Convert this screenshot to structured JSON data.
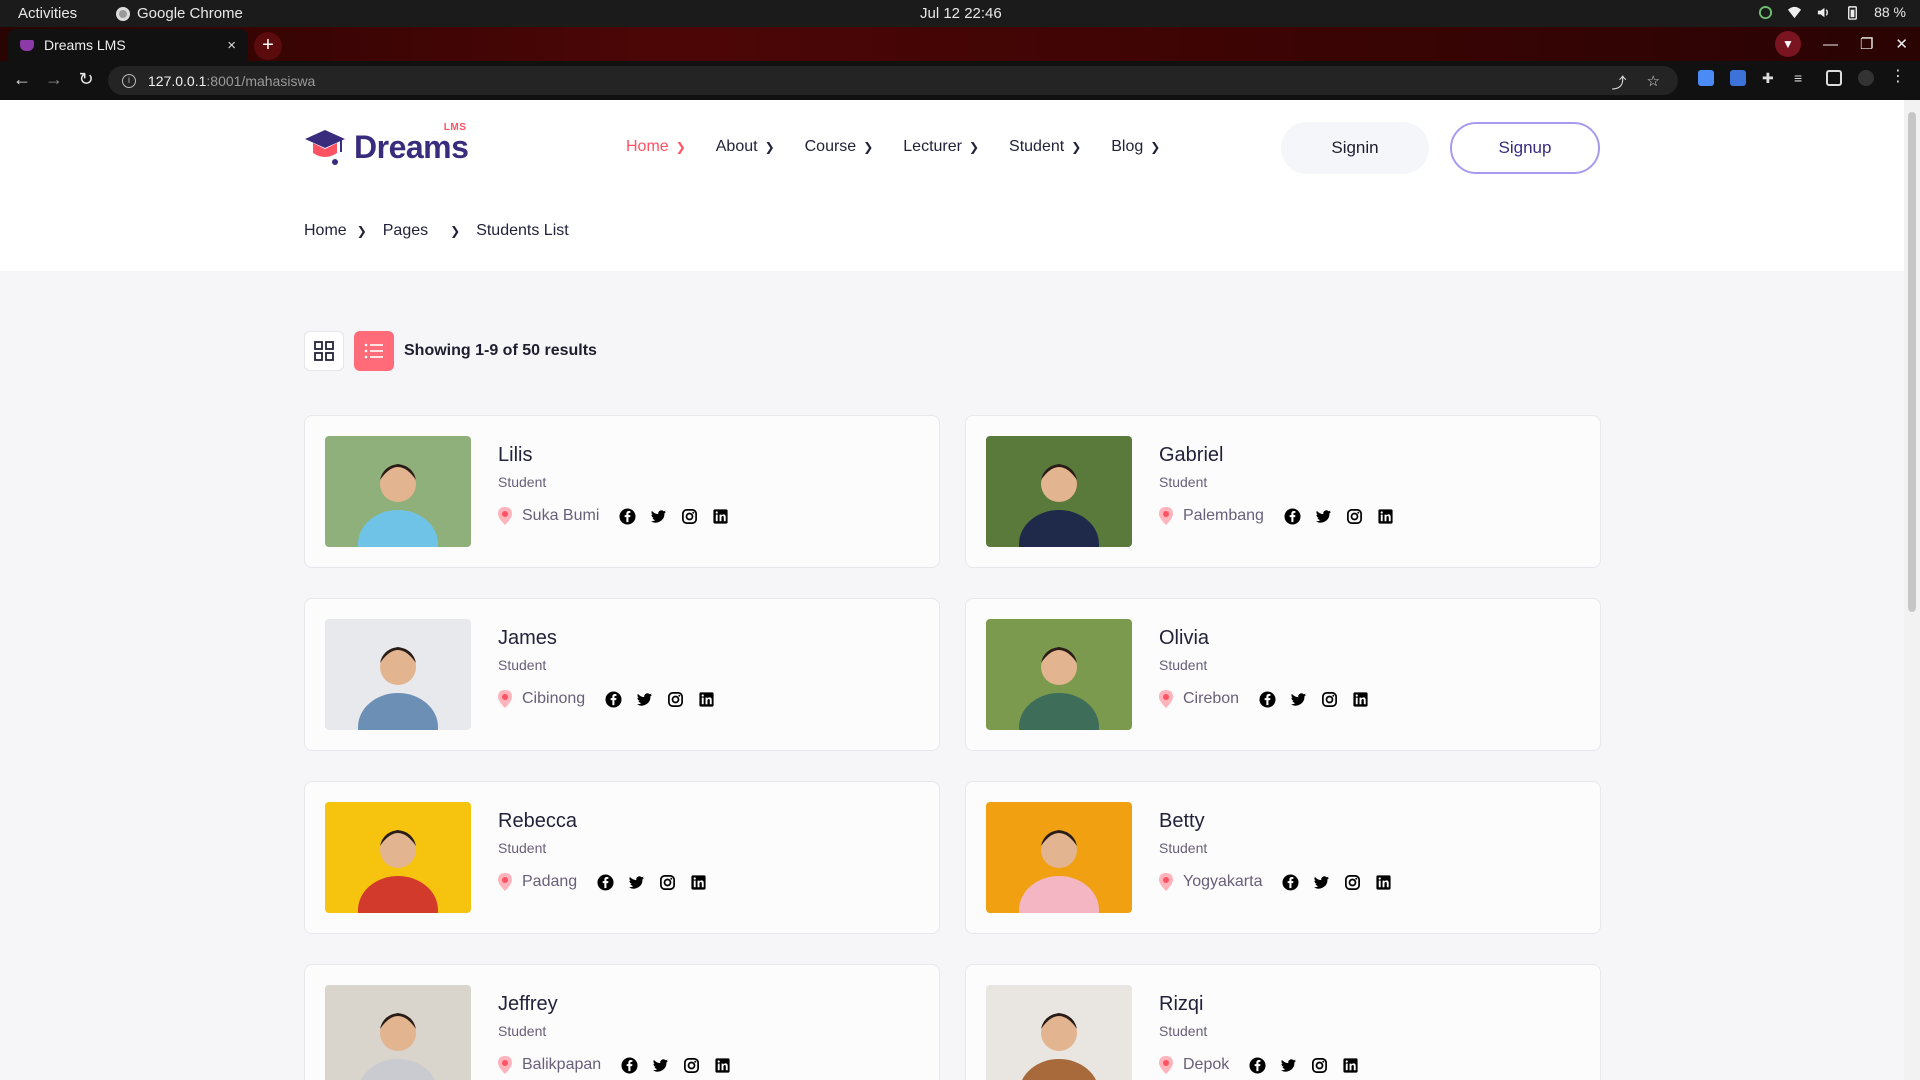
{
  "os": {
    "activities": "Activities",
    "app_name": "Google Chrome",
    "clock": "Jul 12  22:46",
    "battery": "88 %"
  },
  "browser": {
    "tab_title": "Dreams LMS",
    "tab_close": "×",
    "new_tab": "+",
    "url_host": "127.0.0.1",
    "url_path": ":8001/mahasiswa"
  },
  "site": {
    "logo_text": "Dreams",
    "logo_badge": "LMS",
    "nav": [
      {
        "label": "Home",
        "active": true
      },
      {
        "label": "About",
        "active": false
      },
      {
        "label": "Course",
        "active": false
      },
      {
        "label": "Lecturer",
        "active": false
      },
      {
        "label": "Student",
        "active": false
      },
      {
        "label": "Blog",
        "active": false
      }
    ],
    "signin_label": "Signin",
    "signup_label": "Signup",
    "breadcrumb": [
      "Home",
      "Pages",
      "Students List"
    ],
    "results_text": "Showing 1-9 of 50 results",
    "accent_color": "#ff5364",
    "brand_color": "#392c7d"
  },
  "students": [
    {
      "name": "Lilis",
      "role": "Student",
      "location": "Suka Bumi",
      "photo_bg": "#8fb07a",
      "shirt": "#6fc3e6"
    },
    {
      "name": "Gabriel",
      "role": "Student",
      "location": "Palembang",
      "photo_bg": "#5a7a3c",
      "shirt": "#1f2a4a"
    },
    {
      "name": "James",
      "role": "Student",
      "location": "Cibinong",
      "photo_bg": "#e8e9ec",
      "shirt": "#6c8fb5"
    },
    {
      "name": "Olivia",
      "role": "Student",
      "location": "Cirebon",
      "photo_bg": "#7c9a4e",
      "shirt": "#3e6e5a"
    },
    {
      "name": "Rebecca",
      "role": "Student",
      "location": "Padang",
      "photo_bg": "#f6c40e",
      "shirt": "#d23a2c"
    },
    {
      "name": "Betty",
      "role": "Student",
      "location": "Yogyakarta",
      "photo_bg": "#f0a010",
      "shirt": "#f3b6c2"
    },
    {
      "name": "Jeffrey",
      "role": "Student",
      "location": "Balikpapan",
      "photo_bg": "#d9d4cc",
      "shirt": "#c9cbd0"
    },
    {
      "name": "Rizqi",
      "role": "Student",
      "location": "Depok",
      "photo_bg": "#e9e6e1",
      "shirt": "#a86a3a"
    }
  ]
}
